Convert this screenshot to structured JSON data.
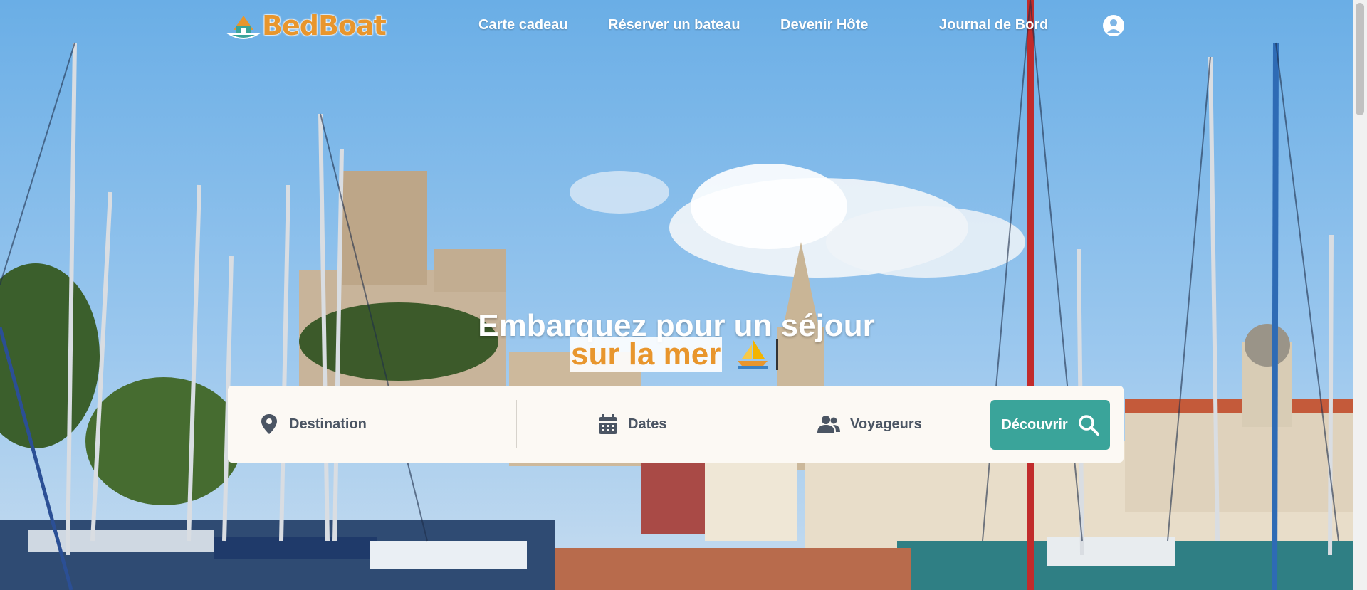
{
  "brand": {
    "name": "BedBoat",
    "logo_icon": "boat-house-logo-icon"
  },
  "nav": {
    "items": [
      {
        "label": "Carte cadeau"
      },
      {
        "label": "Réserver un bateau"
      },
      {
        "label": "Devenir Hôte"
      },
      {
        "label": "Journal de Bord"
      }
    ],
    "account_icon": "user-circle-icon"
  },
  "hero": {
    "headline": "Embarquez pour un séjour",
    "highlight": "sur la mer",
    "emoji_icon": "sailboat-icon"
  },
  "search": {
    "destination": {
      "label": "Destination",
      "icon": "map-pin-icon"
    },
    "dates": {
      "label": "Dates",
      "icon": "calendar-icon"
    },
    "travelers": {
      "label": "Voyageurs",
      "icon": "users-icon"
    },
    "submit": {
      "label": "Découvrir",
      "icon": "search-icon"
    }
  },
  "colors": {
    "brand_orange": "#e8962d",
    "teal": "#3aa49a",
    "panel": "#fcf9f4",
    "text_muted": "#4b5563"
  }
}
